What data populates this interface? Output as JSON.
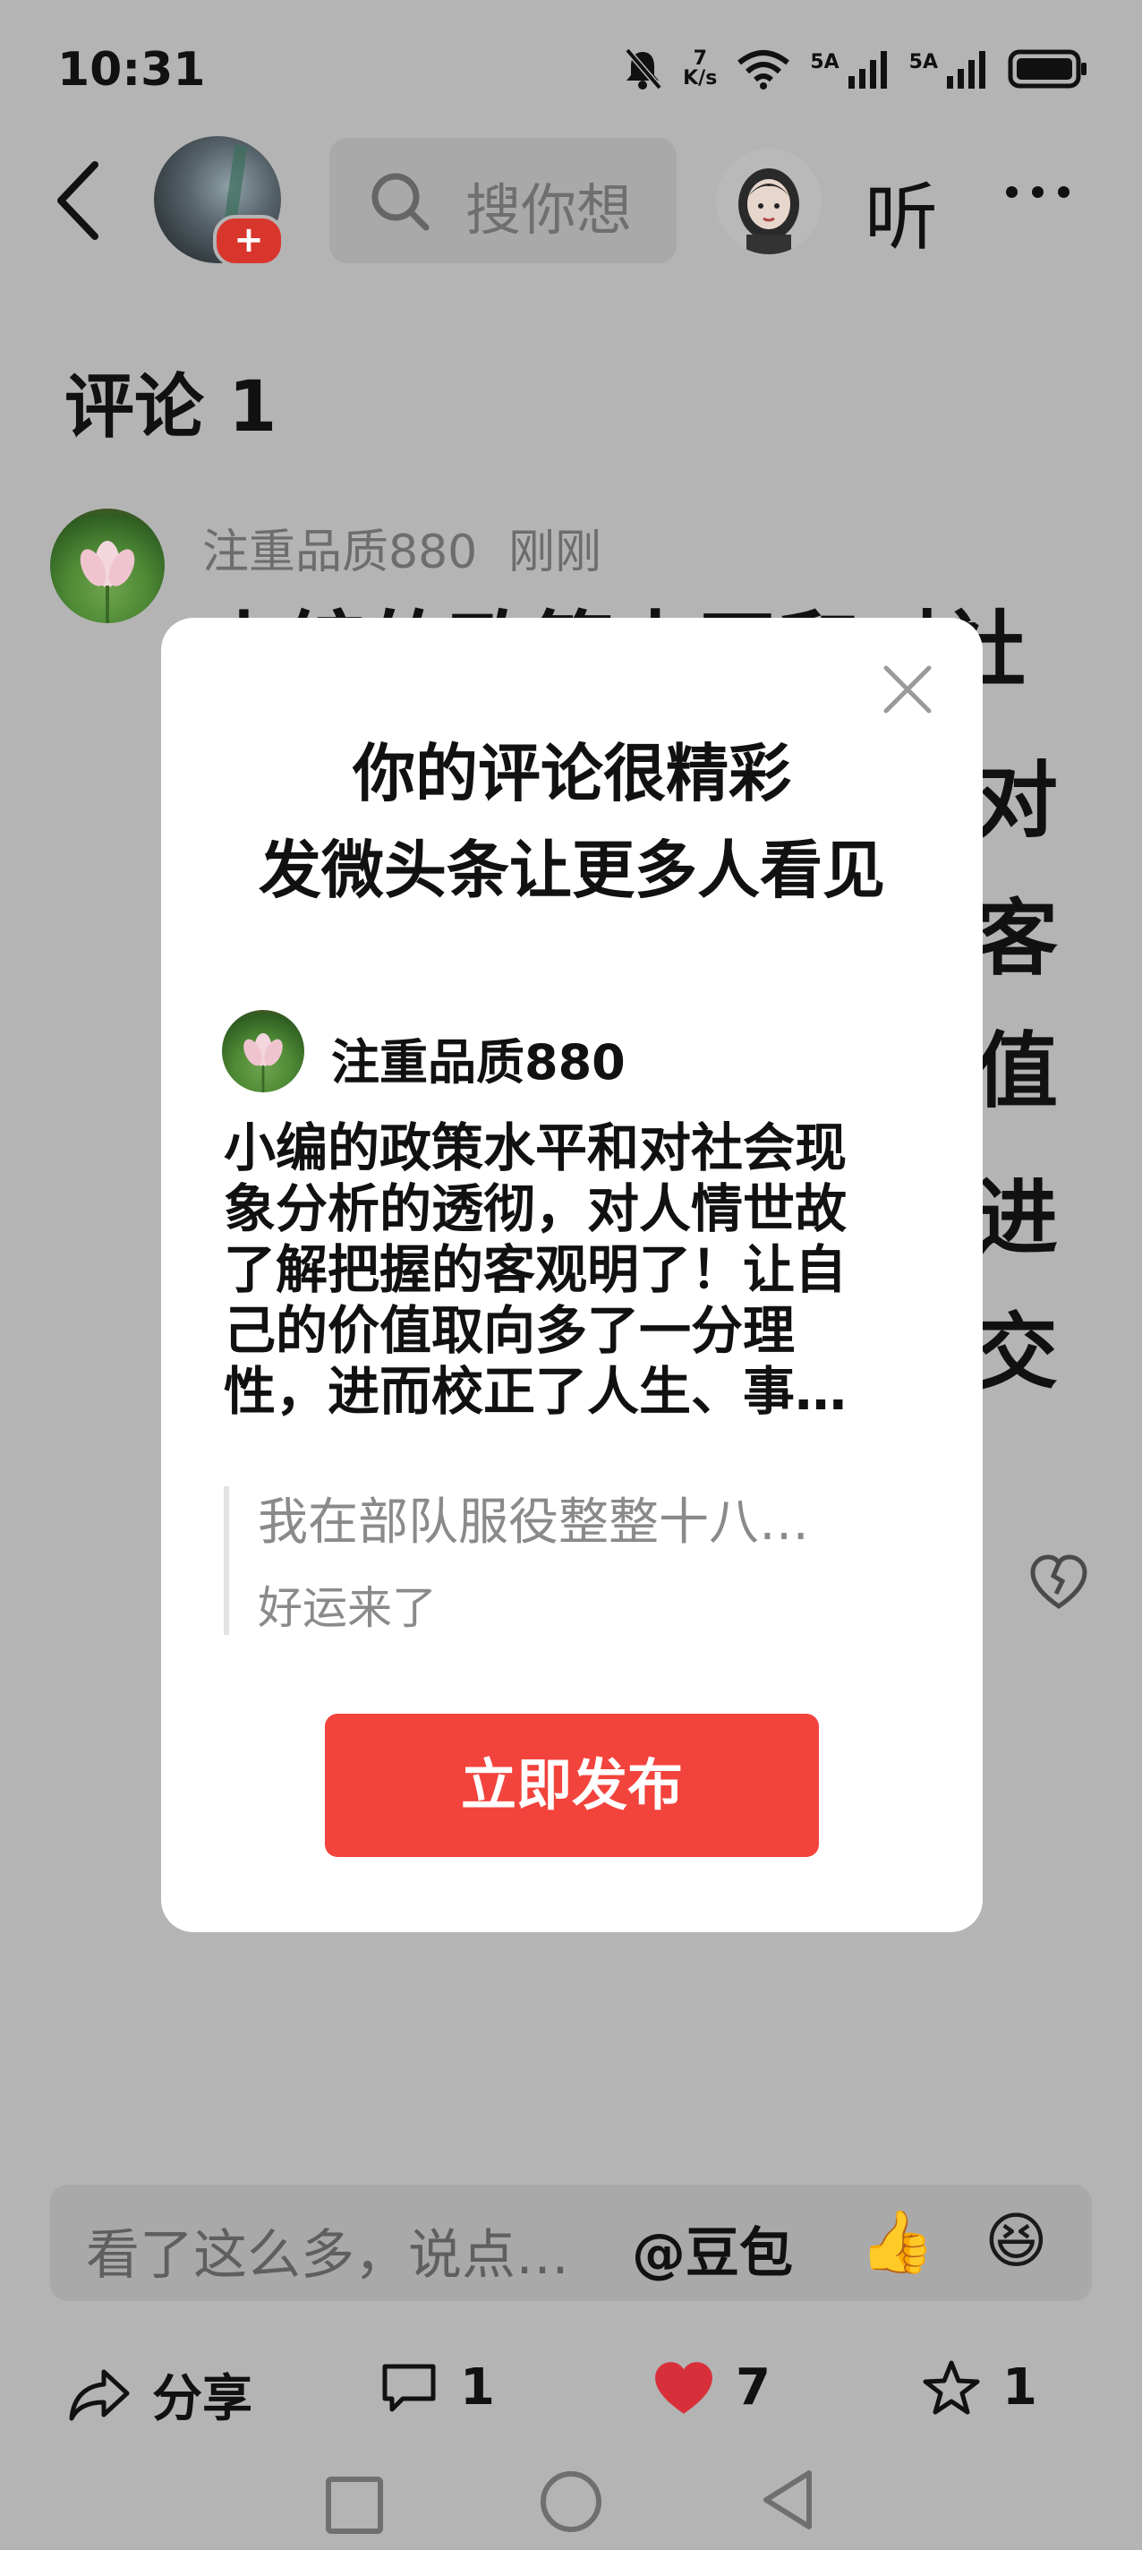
{
  "status_bar": {
    "time": "10:31",
    "net_speed_value": "7",
    "net_speed_unit": "K/s",
    "sim1": "5A",
    "sim2": "5A"
  },
  "header": {
    "search_placeholder": "搜你想",
    "listen_label": "听",
    "plus_badge": "+"
  },
  "comments": {
    "title": "评论 1",
    "item": {
      "user": "注重品质880",
      "time": "刚刚",
      "background_lines": [
        "小编的政策水平和对社",
        "对",
        "客",
        "值",
        "进",
        "交"
      ]
    }
  },
  "modal": {
    "title_line1": "你的评论很精彩",
    "title_line2": "发微头条让更多人看见",
    "user": "注重品质880",
    "body_lines": [
      "小编的政策水平和对社会现",
      "象分析的透彻，对人情世故",
      "了解把握的客观明了！让自",
      "己的价值取向多了一分理",
      "性，进而校正了人生、事…"
    ],
    "quote_text": "我在部队服役整整十八…",
    "quote_subtext": "好运来了",
    "publish_button": "立即发布"
  },
  "input_bar": {
    "placeholder": "看了这么多，说点…",
    "mention": "@豆包"
  },
  "actions": {
    "share": "分享",
    "comments": "1",
    "likes": "7",
    "favorites": "1"
  },
  "colors": {
    "overlay_bg": "#b4b4b4",
    "publish_red": "#f2433c",
    "like_red": "#d8303a"
  }
}
